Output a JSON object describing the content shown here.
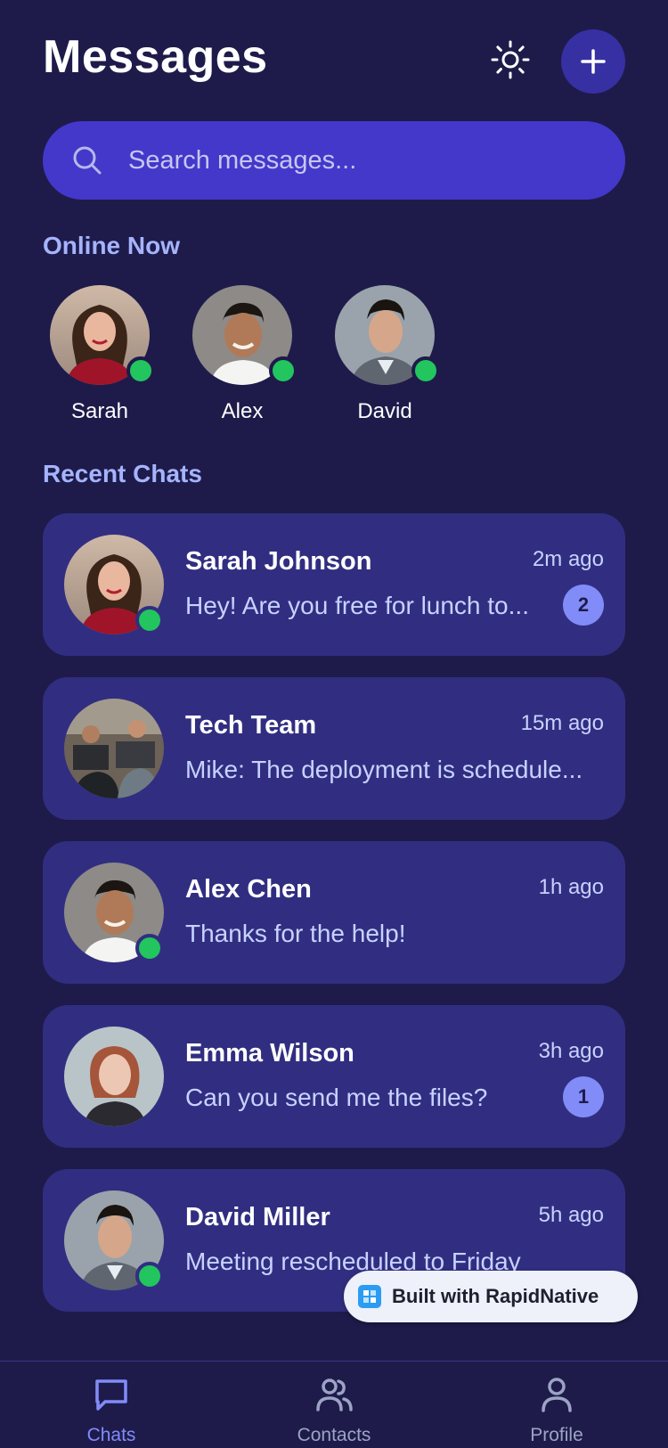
{
  "header": {
    "title": "Messages"
  },
  "search": {
    "placeholder": "Search messages..."
  },
  "sections": {
    "online": "Online Now",
    "recent": "Recent Chats"
  },
  "online_users": [
    {
      "name": "Sarah",
      "online": true
    },
    {
      "name": "Alex",
      "online": true
    },
    {
      "name": "David",
      "online": true
    }
  ],
  "chats": [
    {
      "name": "Sarah Johnson",
      "time": "2m ago",
      "message": "Hey! Are you free for lunch to...",
      "unread": "2",
      "online": true
    },
    {
      "name": "Tech Team",
      "time": "15m ago",
      "message": "Mike: The deployment is schedule...",
      "unread": "",
      "online": false
    },
    {
      "name": "Alex Chen",
      "time": "1h ago",
      "message": "Thanks for the help!",
      "unread": "",
      "online": true
    },
    {
      "name": "Emma Wilson",
      "time": "3h ago",
      "message": "Can you send me the files?",
      "unread": "1",
      "online": false
    },
    {
      "name": "David Miller",
      "time": "5h ago",
      "message": "Meeting rescheduled to Friday",
      "unread": "",
      "online": true
    }
  ],
  "built_badge": "Built with RapidNative",
  "nav": [
    {
      "label": "Chats",
      "icon": "chat-bubble-icon",
      "active": true
    },
    {
      "label": "Contacts",
      "icon": "users-icon",
      "active": false
    },
    {
      "label": "Profile",
      "icon": "user-icon",
      "active": false
    }
  ],
  "colors": {
    "background": "#1e1b4b",
    "card": "#312e81",
    "search": "#4338ca",
    "accent": "#818cf8",
    "online_green": "#22c55e",
    "section_title": "#a5b4fc"
  }
}
